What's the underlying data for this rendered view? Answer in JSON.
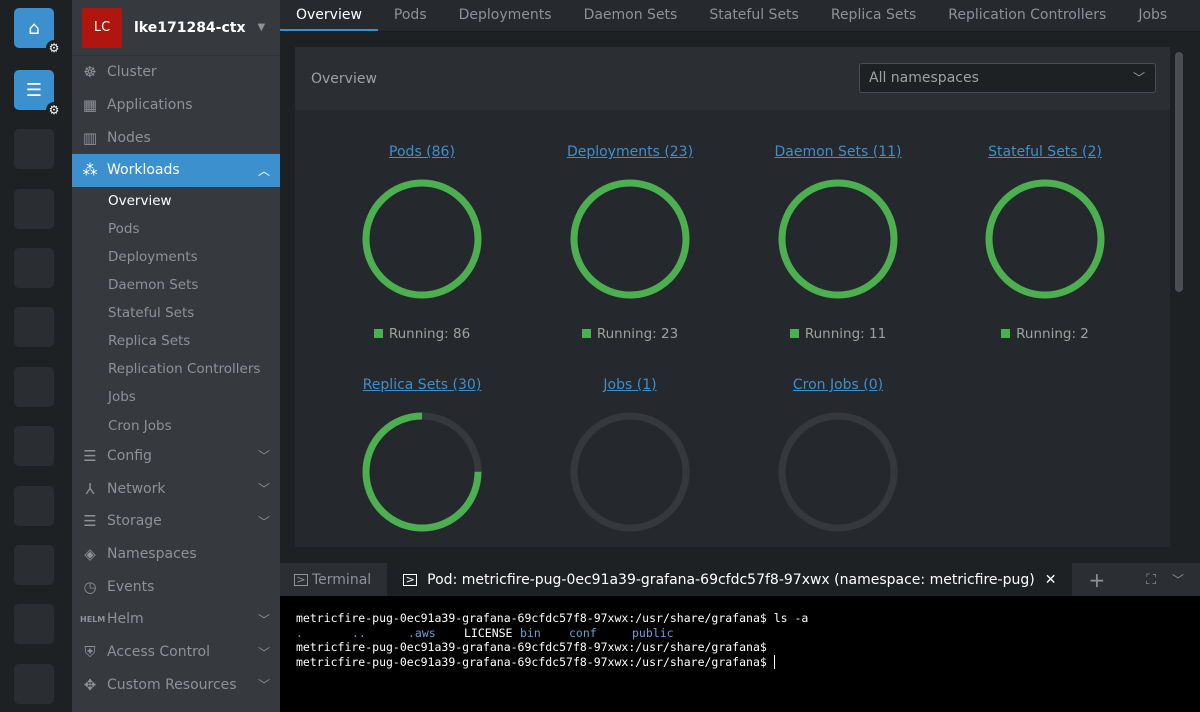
{
  "rail": {
    "home_icon": "home-icon",
    "catalog_icon": "list-icon"
  },
  "context": {
    "initials": "LC",
    "name": "lke171284-ctx",
    "color": "#b0160f"
  },
  "sidebar": {
    "items": [
      {
        "label": "Cluster",
        "icon": "helm-wheel-icon"
      },
      {
        "label": "Applications",
        "icon": "grid-icon"
      },
      {
        "label": "Nodes",
        "icon": "nodes-icon"
      },
      {
        "label": "Workloads",
        "icon": "cubes-icon"
      },
      {
        "label": "Config",
        "icon": "list-icon"
      },
      {
        "label": "Network",
        "icon": "network-icon"
      },
      {
        "label": "Storage",
        "icon": "storage-icon"
      },
      {
        "label": "Namespaces",
        "icon": "layers-icon"
      },
      {
        "label": "Events",
        "icon": "clock-icon"
      },
      {
        "label": "Helm",
        "icon": "helm-icon"
      },
      {
        "label": "Access Control",
        "icon": "shield-icon"
      },
      {
        "label": "Custom Resources",
        "icon": "puzzle-icon"
      }
    ],
    "workloads_sub": [
      "Overview",
      "Pods",
      "Deployments",
      "Daemon Sets",
      "Stateful Sets",
      "Replica Sets",
      "Replication Controllers",
      "Jobs",
      "Cron Jobs"
    ]
  },
  "tabs": [
    "Overview",
    "Pods",
    "Deployments",
    "Daemon Sets",
    "Stateful Sets",
    "Replica Sets",
    "Replication Controllers",
    "Jobs",
    "Cron Jobs"
  ],
  "overview": {
    "title": "Overview",
    "namespace_select": "All namespaces",
    "charts": [
      {
        "title": "Pods (86)",
        "running_fraction": 1,
        "legend": "Running: 86"
      },
      {
        "title": "Deployments (23)",
        "running_fraction": 1,
        "legend": "Running: 23"
      },
      {
        "title": "Daemon Sets (11)",
        "running_fraction": 1,
        "legend": "Running: 11"
      },
      {
        "title": "Stateful Sets (2)",
        "running_fraction": 1,
        "legend": "Running: 2"
      },
      {
        "title": "Replica Sets (30)",
        "running_fraction": 0.75
      },
      {
        "title": "Jobs (1)",
        "running_fraction": 0
      },
      {
        "title": "Cron Jobs (0)",
        "running_fraction": 0
      }
    ],
    "colors": {
      "running": "#4caf50",
      "empty": "#35383d"
    }
  },
  "dock": {
    "tabs": [
      "Terminal",
      "Pod: metricfire-pug-0ec91a39-grafana-69cfdc57f8-97xwx (namespace: metricfire-pug)"
    ]
  },
  "terminal": {
    "prompt": "metricfire-pug-0ec91a39-grafana-69cfdc57f8-97xwx:/usr/share/grafana$",
    "command": " ls -a",
    "ls_output": [
      {
        "name": ".",
        "dir": true
      },
      {
        "name": "..",
        "dir": true
      },
      {
        "name": ".aws",
        "dir": true
      },
      {
        "name": "LICENSE",
        "dir": false
      },
      {
        "name": "bin",
        "dir": true
      },
      {
        "name": "conf",
        "dir": true
      },
      {
        "name": "public",
        "dir": true
      }
    ]
  }
}
